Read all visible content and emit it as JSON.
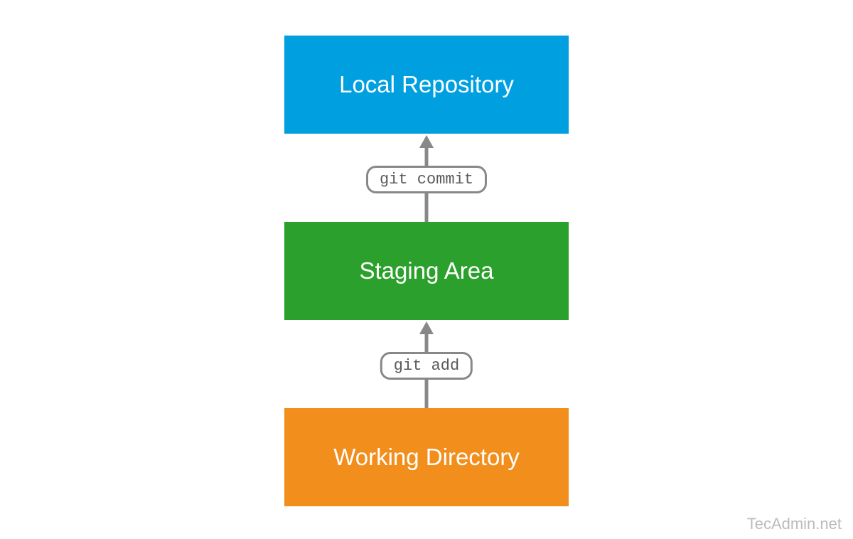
{
  "boxes": {
    "top": "Local Repository",
    "middle": "Staging Area",
    "bottom": "Working Directory"
  },
  "arrows": {
    "upper_label": "git commit",
    "lower_label": "git add"
  },
  "credit": "TecAdmin.net",
  "colors": {
    "top": "#00a0e0",
    "middle": "#2ca02c",
    "bottom": "#f18e1c",
    "arrow": "#888888"
  }
}
